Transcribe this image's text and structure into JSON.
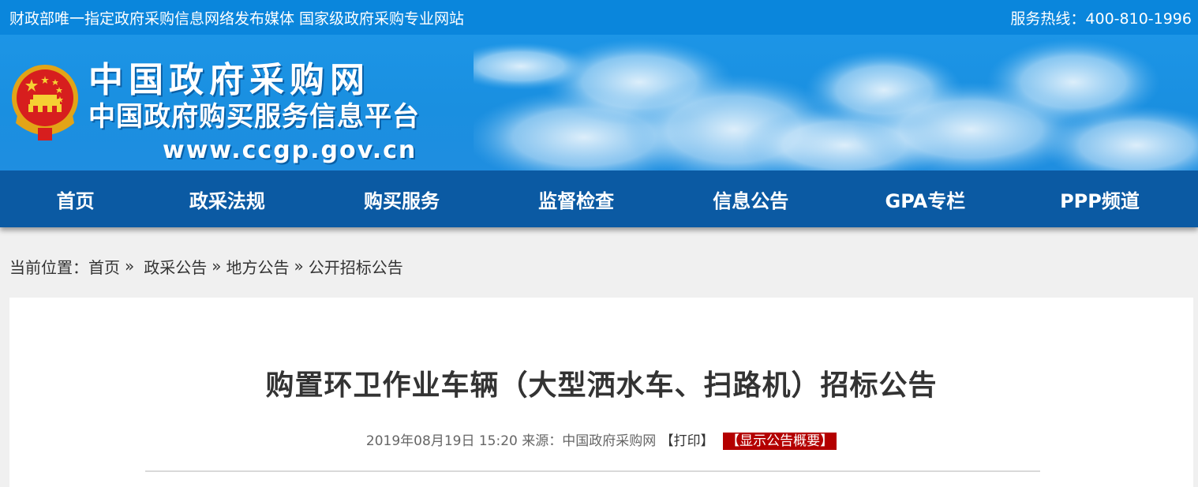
{
  "topbar": {
    "tagline": "财政部唯一指定政府采购信息网络发布媒体 国家级政府采购专业网站",
    "hotline": "服务热线：400-810-1996"
  },
  "banner": {
    "title_main": "中国政府采购网",
    "title_sub": "中国政府购买服务信息平台",
    "url": "www.ccgp.gov.cn"
  },
  "nav": {
    "items": [
      {
        "label": "首页"
      },
      {
        "label": "政采法规"
      },
      {
        "label": "购买服务"
      },
      {
        "label": "监督检查"
      },
      {
        "label": "信息公告"
      },
      {
        "label": "GPA专栏"
      },
      {
        "label": "PPP频道"
      }
    ]
  },
  "breadcrumb": {
    "prefix": "当前位置：",
    "items": [
      "首页",
      "政采公告",
      "地方公告",
      "公开招标公告"
    ],
    "separator": "»"
  },
  "article": {
    "title": "购置环卫作业车辆（大型洒水车、扫路机）招标公告",
    "date": "2019年08月19日 15:20",
    "source_label": "来源：",
    "source": "中国政府采购网",
    "print_label": "【打印】",
    "summary_label": "【显示公告概要】"
  },
  "colors": {
    "topbar": "#0a86dc",
    "nav": "#0b5aa3",
    "summary_badge": "#b40000"
  }
}
